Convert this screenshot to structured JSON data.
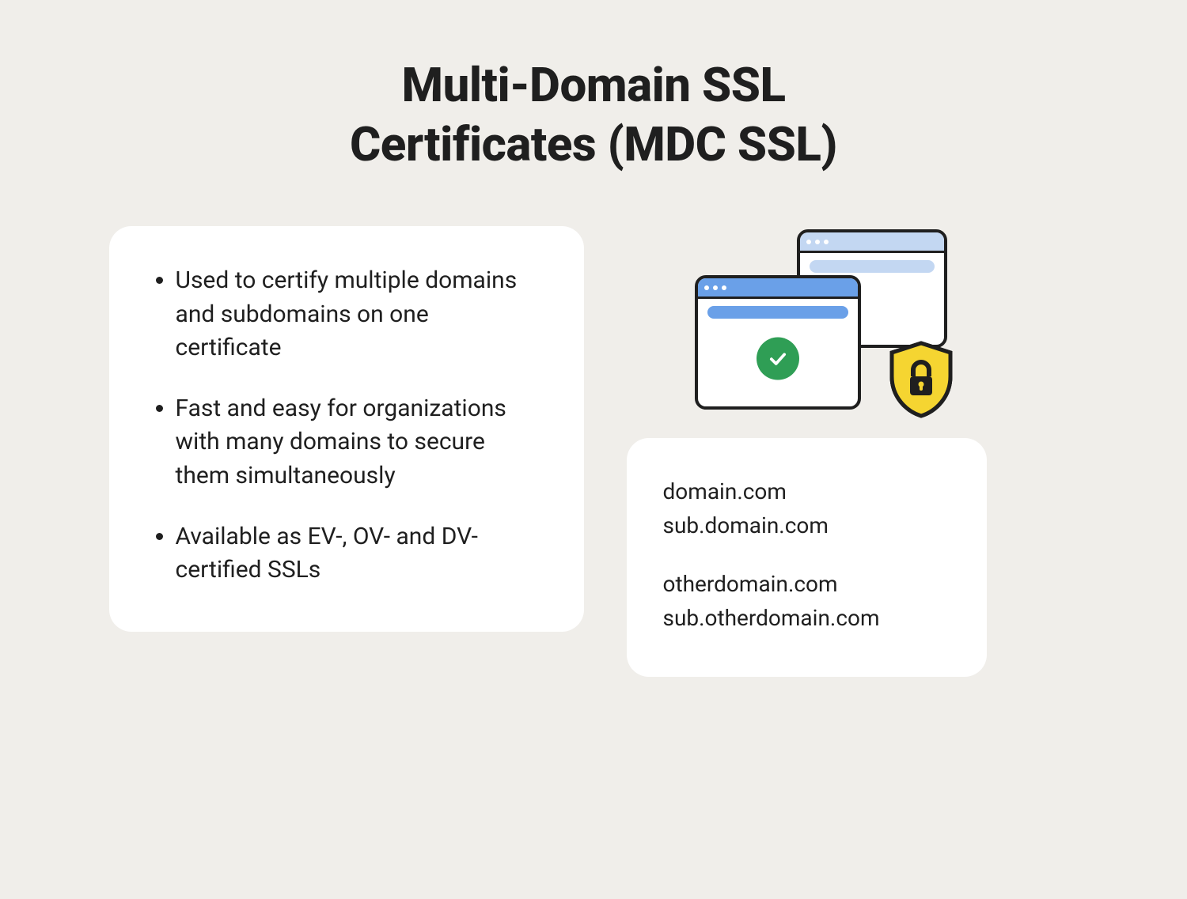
{
  "title_line1": "Multi-Domain SSL",
  "title_line2": "Certificates (MDC SSL)",
  "bullets": [
    "Used to certify multiple domains and subdomains on one certificate",
    "Fast and easy for organizations with many domains to secure them simultaneously",
    "Available as EV-, OV- and DV-certified SSLs"
  ],
  "domains": {
    "group1": [
      "domain.com",
      "sub.domain.com"
    ],
    "group2": [
      "otherdomain.com",
      "sub.otherdomain.com"
    ]
  },
  "illustration": {
    "back_window": "browser-window",
    "front_window": "browser-window-secure",
    "badge": "checkmark",
    "shield": "lock-shield"
  }
}
